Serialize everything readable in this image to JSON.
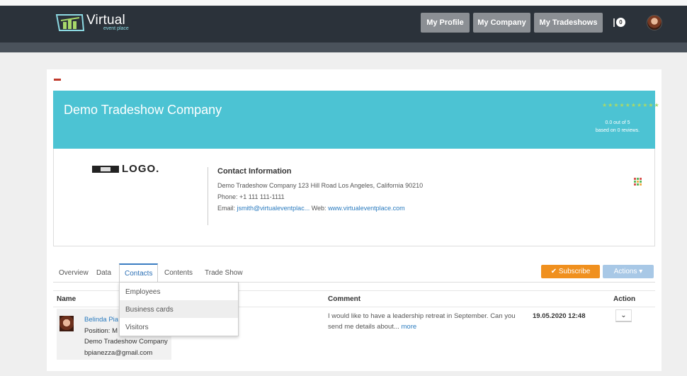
{
  "app": {
    "logo_text": "Virtual",
    "logo_sub": "event place"
  },
  "nav": {
    "profile": "My Profile",
    "company": "My Company",
    "tradeshows": "My Tradeshows",
    "notification_count": "0"
  },
  "banner": {
    "title": "Demo Tradeshow Company",
    "stars": "★★★★★★★★★★",
    "rating_line1": "0.0 out of 5",
    "rating_line2": "based on 0 reviews."
  },
  "company_logo_text": "LOGO.",
  "contact": {
    "heading": "Contact Information",
    "address": "Demo Tradeshow Company 123 Hill Road Los Angeles, California 90210",
    "phone": "Phone: +1 111 111-1111",
    "email_label": "Email: ",
    "email": "jsmith@virtualeventplac...",
    "web_label": " Web: ",
    "web": "www.virtualeventplace.com"
  },
  "tabs": {
    "overview": "Overview",
    "data": "Data",
    "contacts": "Contacts",
    "contents": "Contents",
    "tradeshow": "Trade Show"
  },
  "buttons": {
    "subscribe": "✔ Subscribe",
    "actions": "Actions ▾"
  },
  "dropdown": [
    "Employees",
    "Business cards",
    "Visitors"
  ],
  "table": {
    "headers": {
      "name": "Name",
      "comment": "Comment",
      "action": "Action"
    },
    "row": {
      "name": "Belinda Pia",
      "position": "Position: M",
      "company": "Demo Tradeshow Company",
      "email": "bpianezza@gmail.com",
      "comment": "I would like to have a leadership retreat in September. Can you send me details about... ",
      "more": "more",
      "date": "19.05.2020 12:48",
      "action_icon": "chevron-down-icon"
    }
  },
  "colors": {
    "navbar": "#2b323a",
    "banner": "#4cc3d3",
    "subscribe": "#f0901e",
    "actions": "#a8c8e6",
    "link": "#2a7bbf"
  }
}
